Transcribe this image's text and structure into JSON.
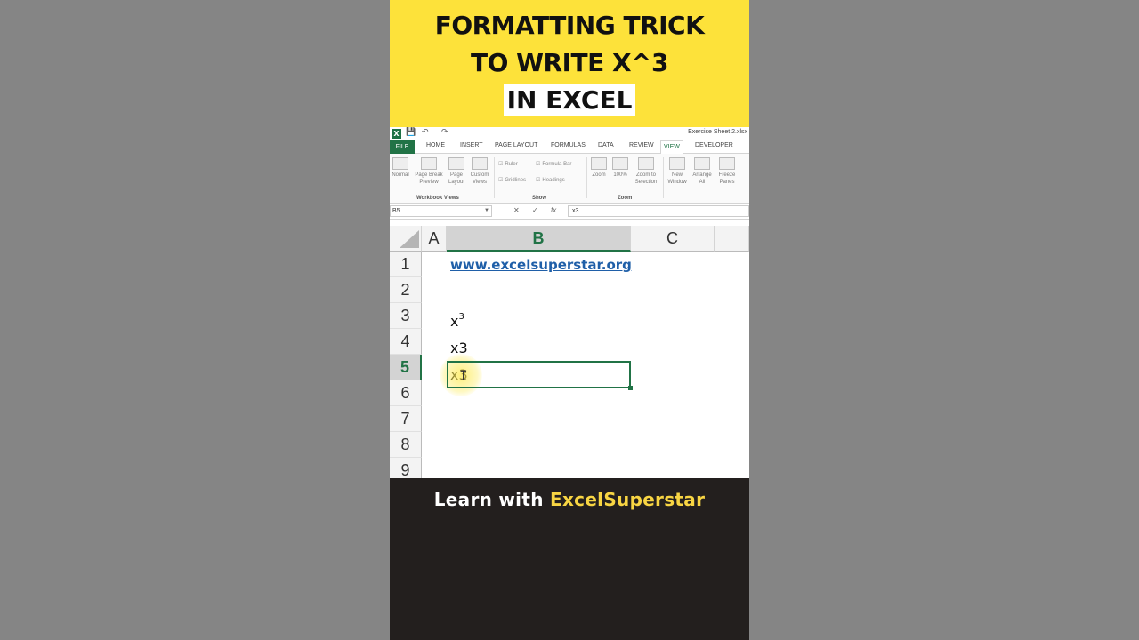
{
  "title": {
    "line1": "FORMATTING TRICK",
    "line2": "TO WRITE X^3",
    "line3": "IN EXCEL"
  },
  "excel": {
    "qat": {
      "file_name": "Exercise Sheet 2.xlsx",
      "save": "💾",
      "undo": "↶",
      "redo": "↷"
    },
    "tabs": [
      "FILE",
      "HOME",
      "INSERT",
      "PAGE LAYOUT",
      "FORMULAS",
      "DATA",
      "REVIEW",
      "VIEW",
      "DEVELOPER"
    ],
    "active_tab": "VIEW",
    "ribbon": {
      "workbook_views": {
        "label": "Workbook Views",
        "buttons": [
          "Normal",
          "Page Break Preview",
          "Page Layout",
          "Custom Views"
        ]
      },
      "show": {
        "label": "Show",
        "checks": [
          "Ruler",
          "Formula Bar",
          "Gridlines",
          "Headings"
        ]
      },
      "zoom": {
        "label": "Zoom",
        "buttons": [
          "Zoom",
          "100%",
          "Zoom to Selection"
        ]
      },
      "window": {
        "buttons": [
          "New Window",
          "Arrange All",
          "Freeze Panes"
        ]
      }
    },
    "formula_bar": {
      "name_box": "B5",
      "cancel": "✕",
      "enter": "✓",
      "fx": "fx",
      "value": "x3"
    },
    "columns": [
      "A",
      "B",
      "C"
    ],
    "selected_column": "B",
    "rows": [
      "1",
      "2",
      "3",
      "4",
      "5",
      "6",
      "7",
      "8",
      "9"
    ],
    "selected_row": "5",
    "cells": {
      "b1": "www.excelsuperstar.org",
      "b3_base": "x",
      "b3_sup": "3",
      "b4": "x3",
      "b5": "x3"
    },
    "colors": {
      "excel_green": "#217346",
      "link_blue": "#1F5FA8"
    }
  },
  "footer": {
    "prefix": "Learn with ",
    "brand": "ExcelSuperstar"
  },
  "colors": {
    "title_band": "#FDE23A",
    "footer_bg": "#231F1E",
    "brand_yellow": "#F8D543"
  }
}
